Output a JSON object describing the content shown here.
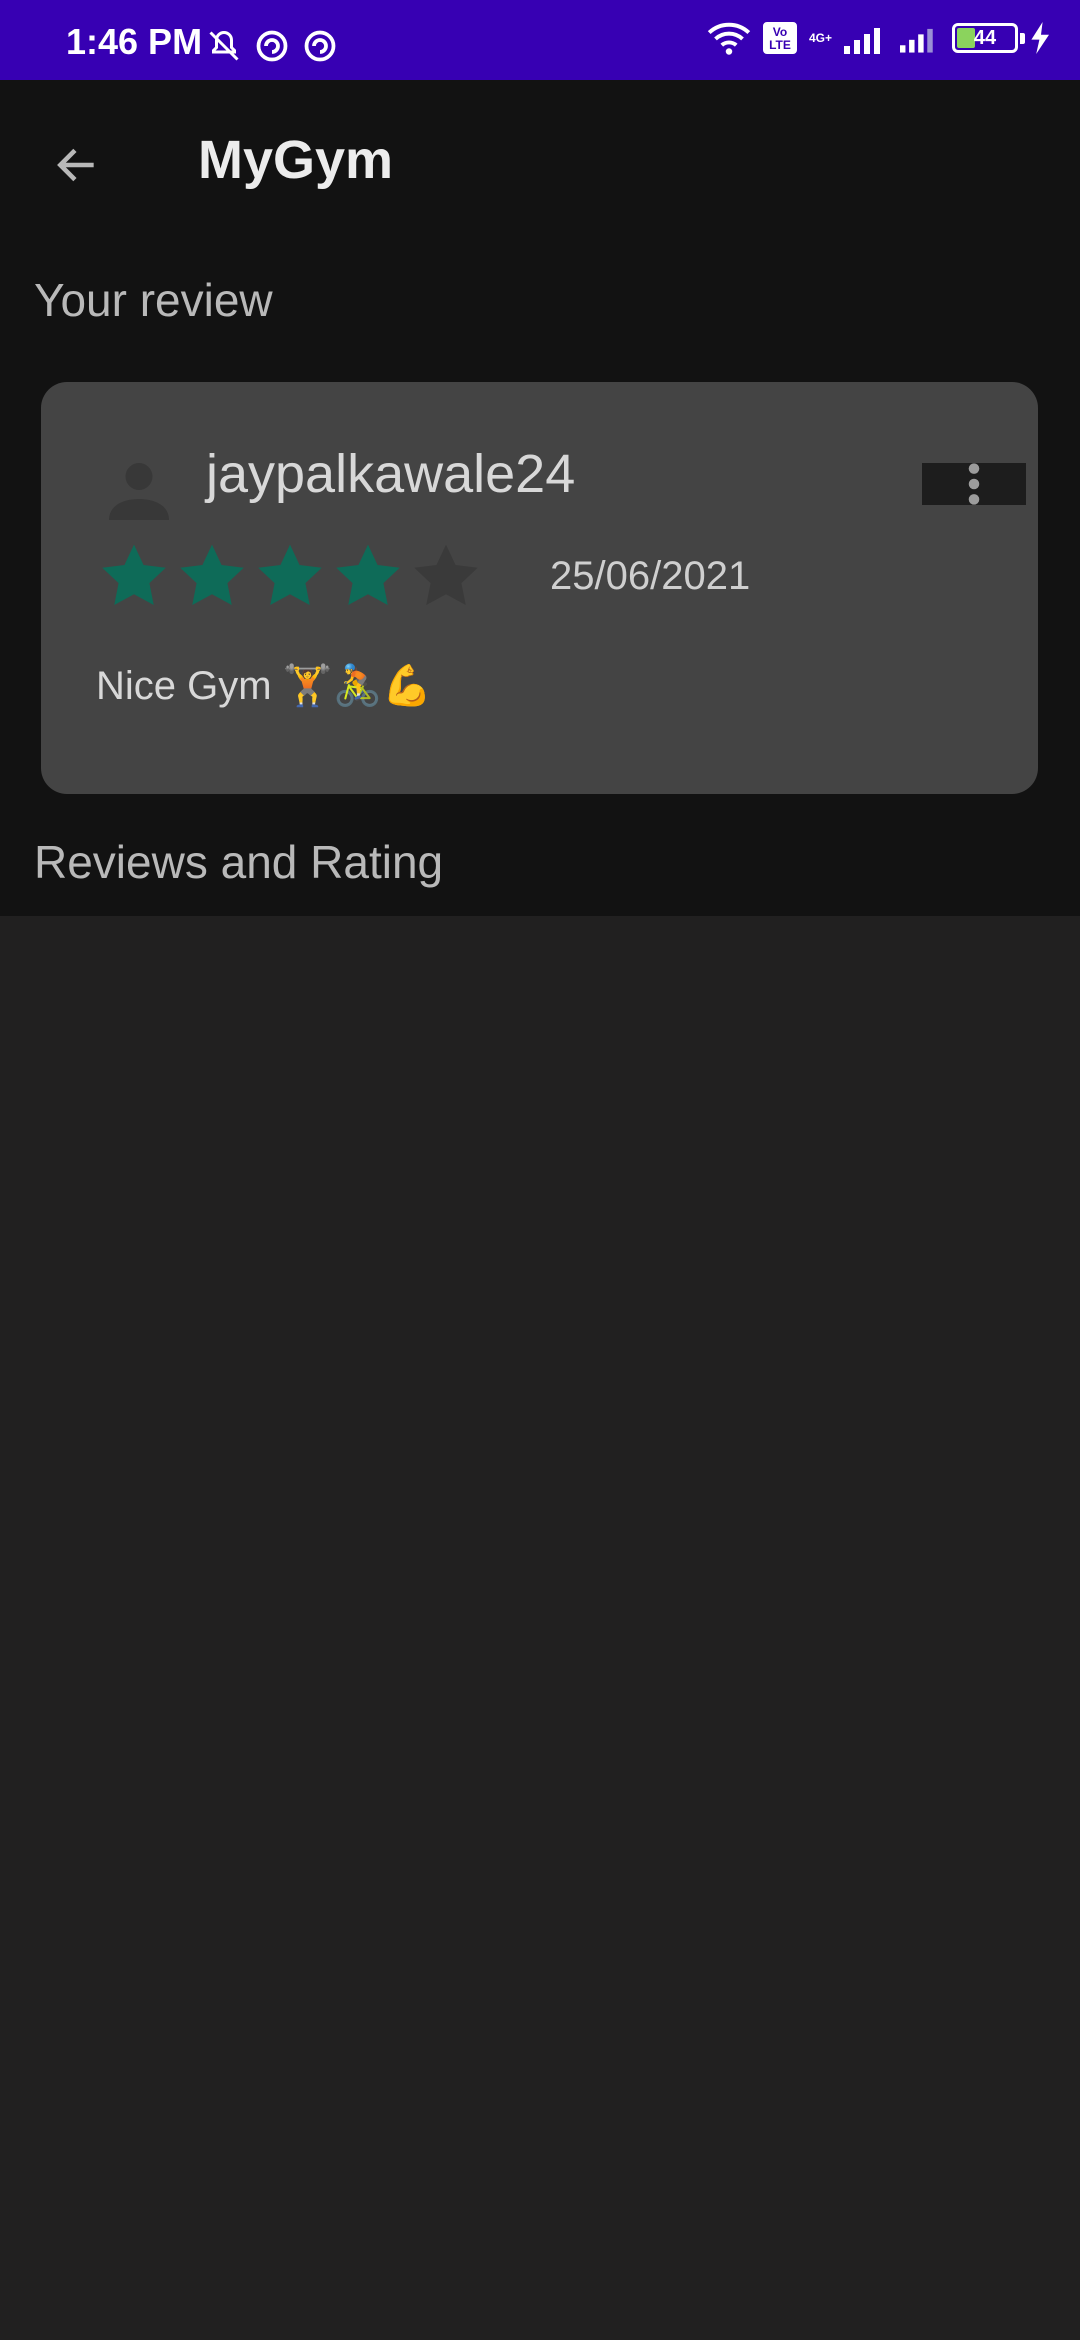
{
  "status_bar": {
    "time": "1:46 PM",
    "left_icons": [
      "mute-bell-icon",
      "sync-icon",
      "sync-icon"
    ],
    "network_badge": "Vo LTE",
    "network_type": "4G+",
    "battery_level": "44",
    "accent": "#3700b3"
  },
  "app_bar": {
    "title": "MyGym",
    "back_icon": "arrow-left-icon"
  },
  "your_review": {
    "section_title": "Your review",
    "username": "jaypalkawale24",
    "rating": 4,
    "max_rating": 5,
    "date": "25/06/2021",
    "text": "Nice Gym 🏋️🚴💪",
    "star_filled_color": "#0e6b58",
    "star_empty_color": "#3a3a3a"
  },
  "reviews_section": {
    "title": "Reviews and Rating",
    "items": []
  }
}
